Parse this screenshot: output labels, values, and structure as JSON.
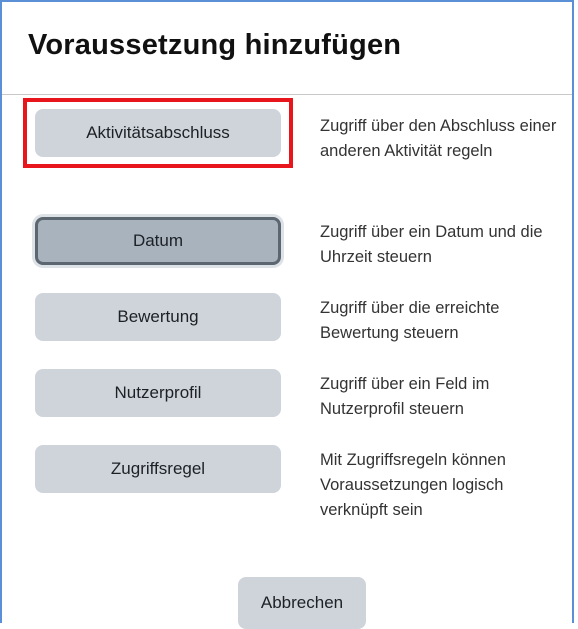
{
  "dialog": {
    "title": "Voraussetzung hinzufügen"
  },
  "options": [
    {
      "label": "Aktivitätsabschluss",
      "description": "Zugriff über den Abschluss einer anderen Aktivität regeln"
    },
    {
      "label": "Datum",
      "description": "Zugriff über ein Datum und die Uhrzeit steuern"
    },
    {
      "label": "Bewertung",
      "description": "Zugriff über die erreichte Bewertung steuern"
    },
    {
      "label": "Nutzerprofil",
      "description": "Zugriff über ein Feld im Nutzerprofil steuern"
    },
    {
      "label": "Zugriffsregel",
      "description": "Mit Zugriffsregeln können Voraussetzungen logisch verknüpft sein"
    }
  ],
  "footer": {
    "cancel_label": "Abbrechen"
  },
  "colors": {
    "button_bg": "#ced4da",
    "focused_button_bg": "#a8b3be",
    "highlight_border": "#e8151c",
    "dialog_border": "#5b8fd6"
  }
}
